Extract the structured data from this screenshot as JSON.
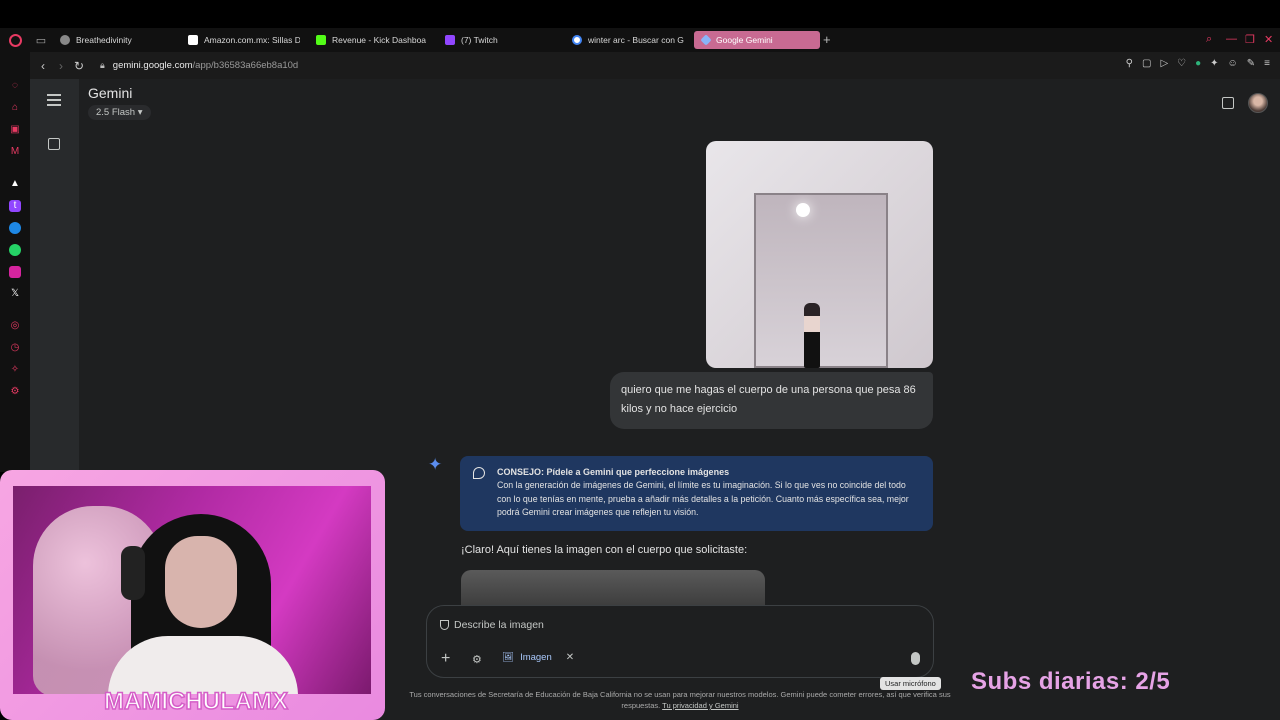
{
  "browser": {
    "tabs": [
      {
        "label": "Breathedivinity",
        "color": "#888888"
      },
      {
        "label": "Amazon.com.mx: Sillas D",
        "color": "#ffffff"
      },
      {
        "label": "Revenue - Kick Dashboa",
        "color": "#53fc18"
      },
      {
        "label": "(7) Twitch",
        "color": "#9146ff"
      },
      {
        "label": "winter arc - Buscar con G",
        "color": "#4285f4"
      },
      {
        "label": "Google Gemini",
        "color": "#8ab4f8"
      }
    ],
    "url_domain": "gemini.google.com",
    "url_path": "/app/b36583a66eb8a10d"
  },
  "gemini": {
    "title": "Gemini",
    "model": "2.5 Flash",
    "user_message": "quiero que me hagas el cuerpo de una persona que pesa 86 kilos y no hace ejercicio",
    "tip_title": "CONSEJO: Pídele a Gemini que perfeccione imágenes",
    "tip_body": "Con la generación de imágenes de Gemini, el límite es tu imaginación. Si lo que ves no coincide del todo con lo que tenías en mente, prueba a añadir más detalles a la petición. Cuanto más específica sea, mejor podrá Gemini crear imágenes que reflejen tu visión.",
    "reply": "¡Claro! Aquí tienes la imagen con el cuerpo que solicitaste:",
    "input_placeholder": "Describe la imagen",
    "chip_label": "Imagen",
    "mic_tooltip": "Usar micrófono",
    "disclaimer": "Tus conversaciones de Secretaría de Educación de Baja California no se usan para mejorar nuestros modelos. Gemini puede cometer errores, así que verifica sus respuestas.",
    "privacy_link": "Tu privacidad y Gemini"
  },
  "overlay": {
    "subs_text": "Subs diarias: 2/5",
    "streamer_name": "MAMICHULAMX"
  }
}
